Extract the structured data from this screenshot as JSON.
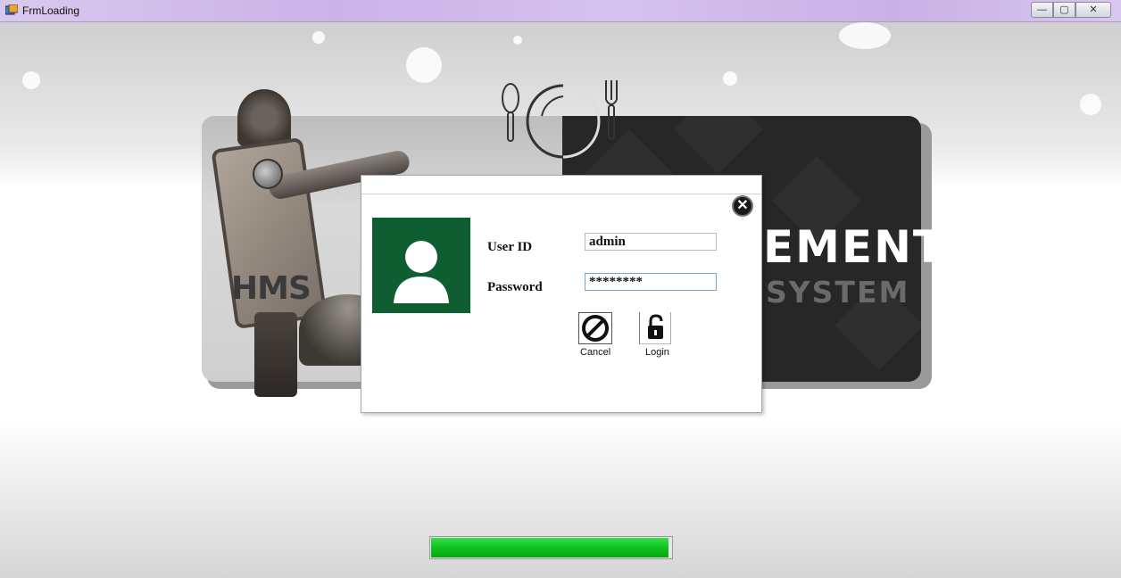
{
  "window": {
    "title": "FrmLoading",
    "controls": {
      "minimize": "—",
      "maximize": "▢",
      "close": "✕"
    }
  },
  "banner": {
    "logo_text": "HMS",
    "headline": "EMENT",
    "subline": "SYSTEM",
    "icons": [
      "spoon-icon",
      "plate-icon",
      "fork-icon"
    ]
  },
  "login": {
    "user_label": "User ID",
    "user_value": "admin",
    "password_label": "Password",
    "password_value": "********",
    "cancel_label": "Cancel",
    "login_label": "Login",
    "avatar_color": "#0f5e32"
  },
  "progress": {
    "fraction": 0.99,
    "color": "#10c21e"
  }
}
